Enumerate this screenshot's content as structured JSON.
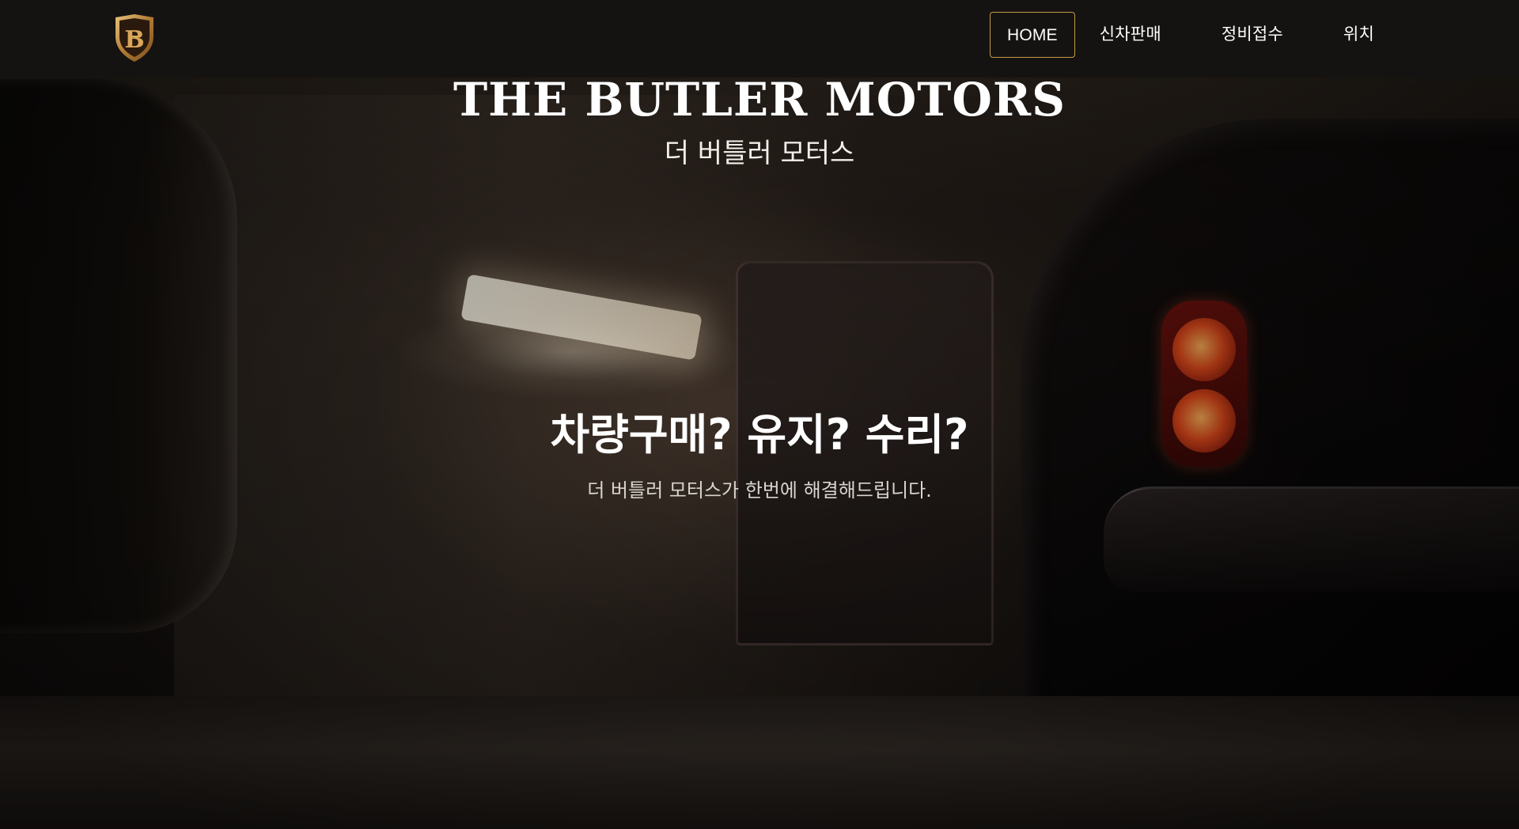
{
  "nav": {
    "logo_icon": "shield-b-crest-icon",
    "items": [
      {
        "label": "HOME",
        "active": true
      },
      {
        "label": "신차판매",
        "active": false
      },
      {
        "label": "정비접수",
        "active": false
      },
      {
        "label": "위치",
        "active": false
      }
    ]
  },
  "hero": {
    "brand_title": "THE BUTLER MOTORS",
    "brand_subtitle": "더 버틀러 모터스",
    "headline": "차량구매? 유지? 수리?",
    "tagline": "더 버틀러 모터스가 한번에 해결해드립니다."
  },
  "colors": {
    "accent_gold": "#c49a4c",
    "navbar_bg": "#161412",
    "text_white": "#ffffff"
  }
}
